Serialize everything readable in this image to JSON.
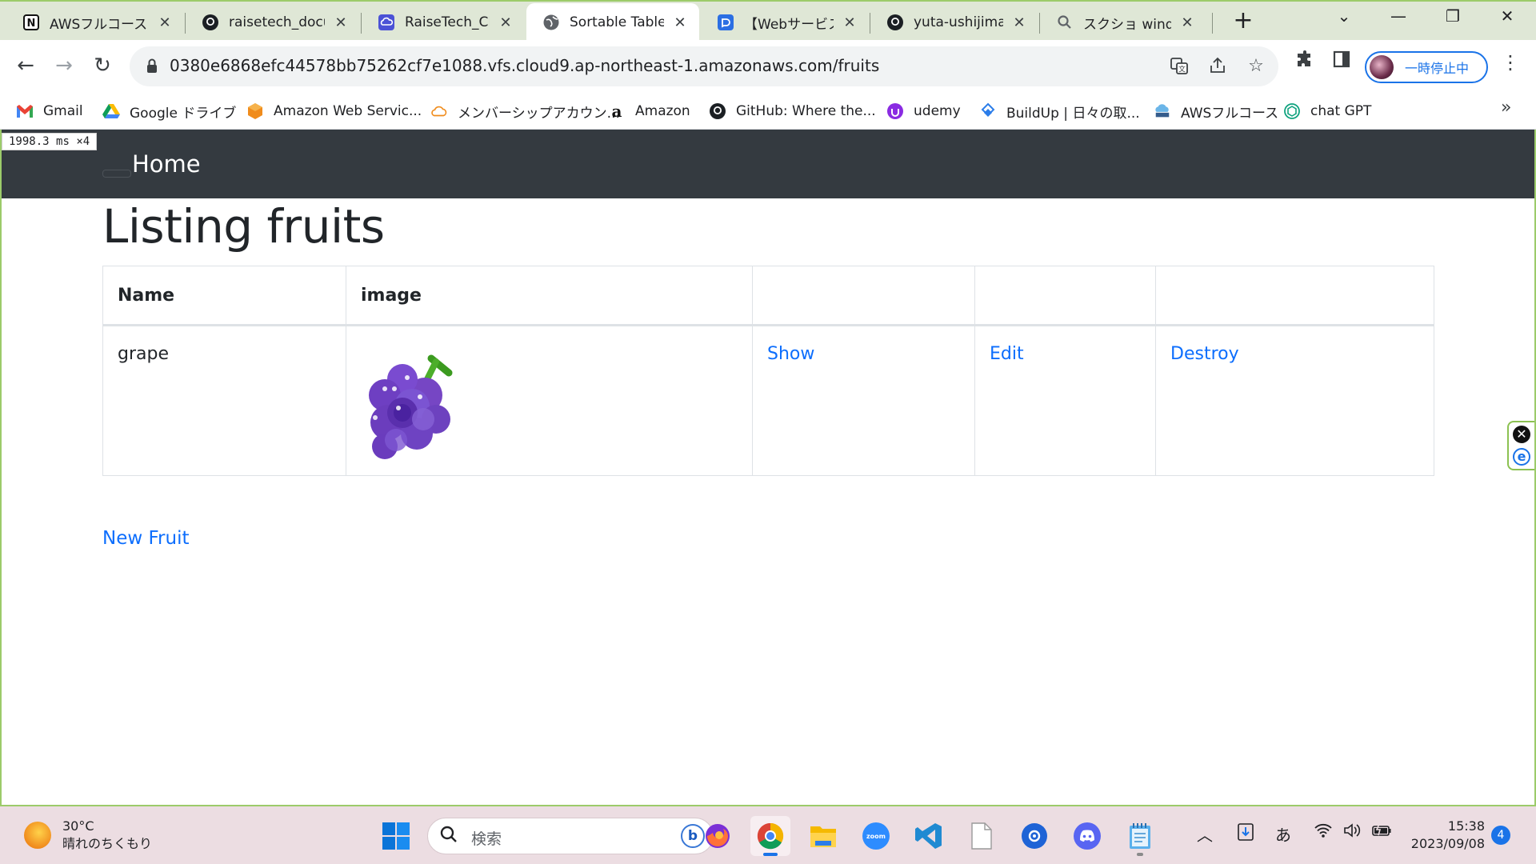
{
  "browser": {
    "tabs": [
      {
        "title": "AWSフルコース 第",
        "icon": "notion-icon",
        "active": false
      },
      {
        "title": "raisetech_docu",
        "icon": "github-icon",
        "active": false
      },
      {
        "title": "RaiseTech_Clou",
        "icon": "cloud-icon",
        "active": false
      },
      {
        "title": "Sortable Table",
        "icon": "globe-icon",
        "active": true
      },
      {
        "title": "【Webサービス開",
        "icon": "chat-icon",
        "active": false
      },
      {
        "title": "yuta-ushijima/",
        "icon": "github-icon",
        "active": false
      },
      {
        "title": "スクショ window",
        "icon": "search-icon",
        "active": false
      }
    ],
    "new_tab": "+",
    "url": "0380e6868efc44578bb75262cf7e1088.vfs.cloud9.ap-northeast-1.amazonaws.com/fruits",
    "profile_label": "一時停止中",
    "bookmarks": [
      {
        "label": "Gmail",
        "icon": "gmail-icon"
      },
      {
        "label": "Google ドライブ",
        "icon": "google-drive-icon"
      },
      {
        "label": "Amazon Web Servic...",
        "icon": "aws-icon"
      },
      {
        "label": "メンバーシップアカウン...",
        "icon": "cloud-outline-icon"
      },
      {
        "label": "Amazon",
        "icon": "amazon-icon"
      },
      {
        "label": "GitHub: Where the...",
        "icon": "github-icon"
      },
      {
        "label": "udemy",
        "icon": "udemy-icon"
      },
      {
        "label": "BuildUp | 日々の取...",
        "icon": "buildup-icon"
      },
      {
        "label": "AWSフルコース",
        "icon": "aws-course-icon"
      },
      {
        "label": "chat GPT",
        "icon": "chatgpt-icon"
      }
    ],
    "bookmarks_more": "»"
  },
  "perf_badge": {
    "time": "1998.3",
    "unit": "ms",
    "mult": "×4"
  },
  "app": {
    "navbar": {
      "home_label": "Home"
    },
    "title": "Listing fruits",
    "table": {
      "headers": [
        "Name",
        "image",
        "",
        "",
        ""
      ],
      "rows": [
        {
          "name": "grape",
          "image": "grape-image",
          "show": "Show",
          "edit": "Edit",
          "destroy": "Destroy"
        }
      ]
    },
    "new_link": "New Fruit"
  },
  "taskbar": {
    "weather_temp": "30°C",
    "weather_desc": "晴れのちくもり",
    "search_placeholder": "検索",
    "ime_label": "あ",
    "time": "15:38",
    "date": "2023/09/08",
    "notifications": "4"
  },
  "colors": {
    "navbar": "#343a40",
    "link": "#0d6efd",
    "accent_frame": "#9ccb6a",
    "taskbar": "#ecdde2"
  }
}
